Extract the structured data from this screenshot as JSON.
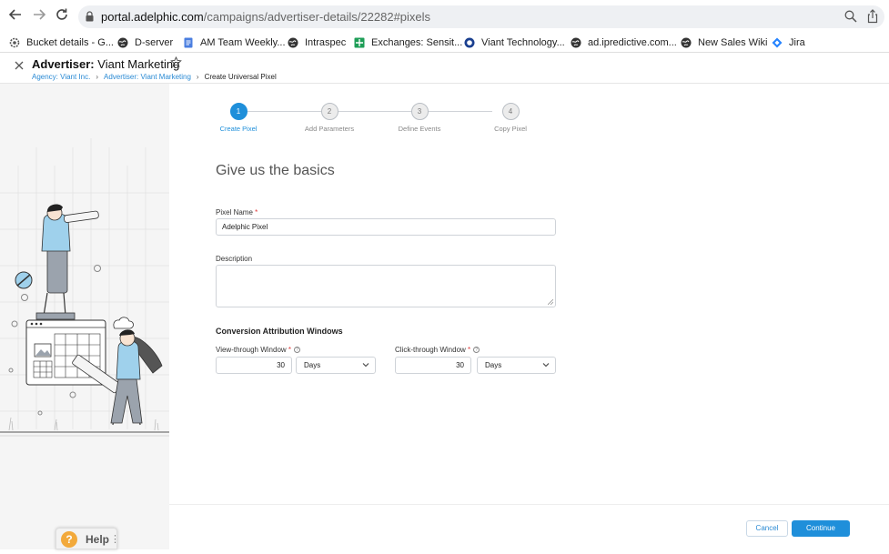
{
  "browser": {
    "url_host": "portal.adelphic.com",
    "url_path": "/campaigns/advertiser-details/22282#pixels",
    "bookmarks": [
      {
        "label": "Bucket details - G...",
        "icon": "gear-icon",
        "color": "#555555"
      },
      {
        "label": "D-server",
        "icon": "globe-icon",
        "color": "#333333"
      },
      {
        "label": "AM Team Weekly...",
        "icon": "docs-icon",
        "color": "#4a7ee0"
      },
      {
        "label": "Intraspec",
        "icon": "globe-icon",
        "color": "#333333"
      },
      {
        "label": "Exchanges: Sensit...",
        "icon": "sheets-icon",
        "color": "#1e9e57"
      },
      {
        "label": "Viant Technology...",
        "icon": "viant-icon",
        "color": "#1a3f8f"
      },
      {
        "label": "ad.ipredictive.com...",
        "icon": "globe-icon",
        "color": "#333333"
      },
      {
        "label": "New Sales Wiki",
        "icon": "globe-icon",
        "color": "#333333"
      },
      {
        "label": "Jira",
        "icon": "jira-icon",
        "color": "#2684ff"
      }
    ]
  },
  "header": {
    "title_prefix": "Advertiser:",
    "title_name": "Viant Marketing",
    "breadcrumbs": [
      {
        "label": "Agency: Viant Inc.",
        "link": true
      },
      {
        "label": "Advertiser: Viant Marketing",
        "link": true
      },
      {
        "label": "Create Universal Pixel",
        "link": false
      }
    ]
  },
  "stepper": {
    "steps": [
      {
        "num": "1",
        "label": "Create Pixel",
        "active": true
      },
      {
        "num": "2",
        "label": "Add Parameters",
        "active": false
      },
      {
        "num": "3",
        "label": "Define Events",
        "active": false
      },
      {
        "num": "4",
        "label": "Copy Pixel",
        "active": false
      }
    ]
  },
  "form": {
    "title": "Give us the basics",
    "pixel_name_label": "Pixel Name",
    "pixel_name_value": "Adelphic Pixel",
    "description_label": "Description",
    "description_value": "",
    "conversion_title": "Conversion Attribution Windows",
    "view_through_label": "View-through Window",
    "view_through_value": "30",
    "view_through_unit": "Days",
    "click_through_label": "Click-through Window",
    "click_through_value": "30",
    "click_through_unit": "Days",
    "required_mark": "*"
  },
  "footer": {
    "cancel_label": "Cancel",
    "continue_label": "Continue"
  },
  "help": {
    "icon_label": "?",
    "label": "Help"
  },
  "colors": {
    "accent": "#1f8fda",
    "required": "#e03a3a"
  }
}
